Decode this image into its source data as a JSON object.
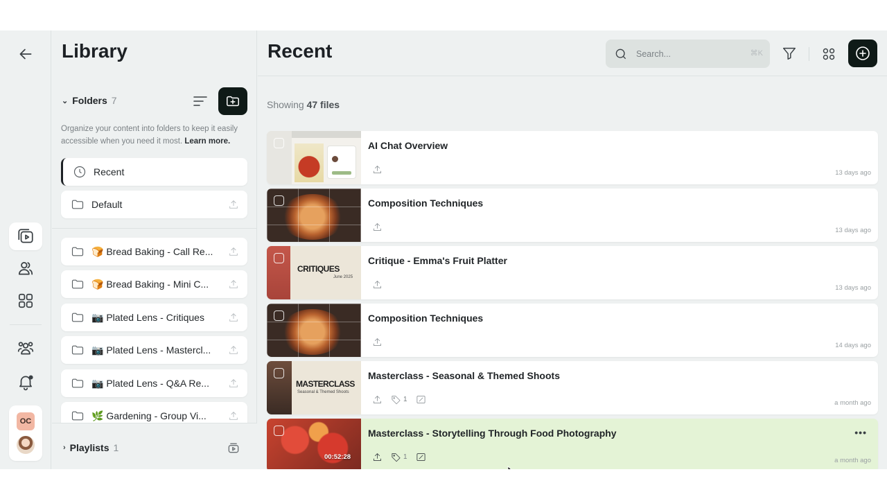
{
  "library": {
    "title": "Library",
    "folders_label": "Folders",
    "folders_count": "7",
    "description": "Organize your content into folders to keep it easily accessible when you need it most.",
    "learn_more": "Learn more.",
    "items": [
      {
        "label": "Recent",
        "icon": "clock-icon",
        "active": true
      },
      {
        "label": "Default",
        "icon": "folder-icon"
      },
      {
        "label": "🍞 Bread Baking - Call Re...",
        "icon": "folder-icon"
      },
      {
        "label": "🍞 Bread Baking - Mini C...",
        "icon": "folder-icon"
      },
      {
        "label": "📷 Plated Lens - Critiques",
        "icon": "folder-icon"
      },
      {
        "label": "📷 Plated Lens - Mastercl...",
        "icon": "folder-icon"
      },
      {
        "label": "📷 Plated Lens - Q&A Re...",
        "icon": "folder-icon"
      },
      {
        "label": "🌿 Gardening - Group Vi...",
        "icon": "folder-icon"
      }
    ],
    "playlists_label": "Playlists",
    "playlists_count": "1"
  },
  "rail": {
    "account_initials": "OC"
  },
  "main": {
    "title": "Recent",
    "search_placeholder": "Search...",
    "search_shortcut": "⌘K",
    "showing_prefix": "Showing",
    "showing_count": "47 files",
    "files": [
      {
        "title": "AI Chat Overview",
        "date": "13 days ago",
        "thumb": "ai"
      },
      {
        "title": "Composition Techniques",
        "date": "13 days ago",
        "thumb": "comp"
      },
      {
        "title": "Critique - Emma's Fruit Platter",
        "date": "13 days ago",
        "thumb": "crit",
        "thumb_text": "CRITIQUES",
        "thumb_sub": "June 2025"
      },
      {
        "title": "Composition Techniques",
        "date": "14 days ago",
        "thumb": "comp"
      },
      {
        "title": "Masterclass - Seasonal & Themed Shoots",
        "date": "a month ago",
        "thumb": "mc",
        "thumb_text": "MASTERCLASS",
        "thumb_sub": "Seasonal & Themed Shoots",
        "tags": "1"
      },
      {
        "title": "Masterclass - Storytelling Through Food Photography",
        "date": "a month ago",
        "thumb": "food",
        "duration": "00:52:28",
        "tags": "1",
        "hovered": true
      }
    ]
  },
  "colors": {
    "accent_dark": "#0f1a17",
    "hover_row": "#e4f3d6",
    "background": "#eef1f1"
  }
}
